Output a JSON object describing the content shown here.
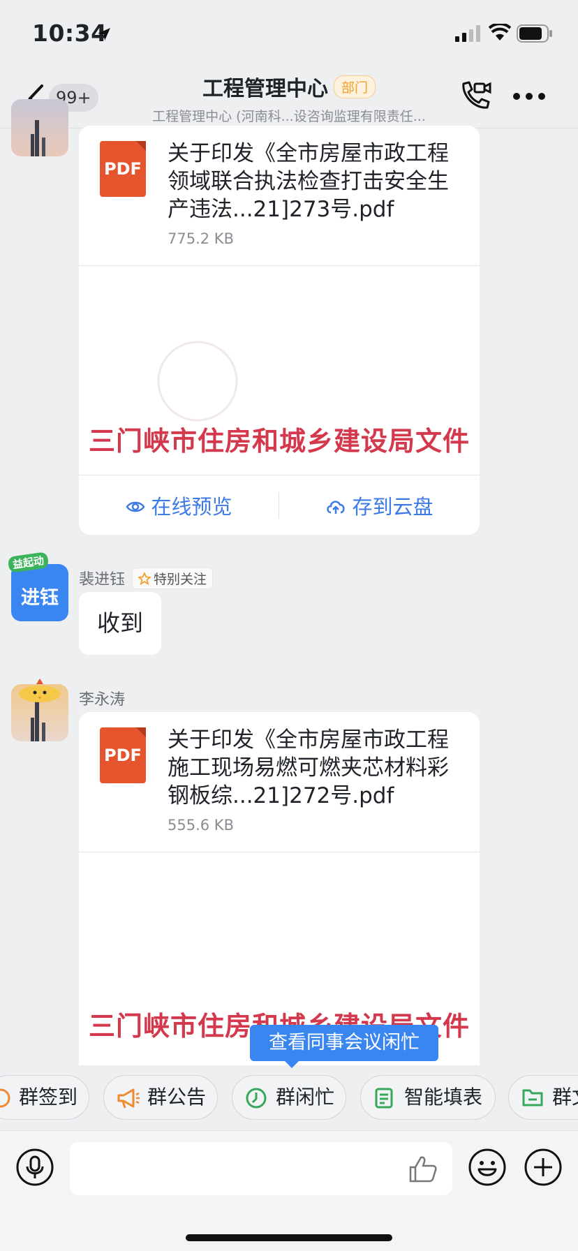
{
  "status_bar": {
    "time": "10:34"
  },
  "header": {
    "unread_badge": "99+",
    "title": "工程管理中心",
    "tag": "部门",
    "subtitle": "工程管理中心 (河南科...设咨询监理有限责任..."
  },
  "messages": [
    {
      "type": "file",
      "file_name": "关于印发《全市房屋市政工程领域联合执法检查打击安全生产违法...21]273号.pdf",
      "file_size": "775.2 KB",
      "preview_heading": "三门峡市住房和城乡建设局文件",
      "actions": {
        "preview": "在线预览",
        "save": "存到云盘"
      }
    },
    {
      "type": "text",
      "sender": "裴进钰",
      "avatar_text": "进钰",
      "avatar_badge": "益起动",
      "sender_tag": "特别关注",
      "text": "收到"
    },
    {
      "type": "file",
      "sender": "李永涛",
      "file_name": "关于印发《全市房屋市政工程施工现场易燃可燃夹芯材料彩钢板综...21]272号.pdf",
      "file_size": "555.6 KB",
      "preview_heading": "三门峡市住房和城乡建设局文件"
    }
  ],
  "tooltip": "查看同事会议闲忙",
  "quick_bar": [
    "群签到",
    "群公告",
    "群闲忙",
    "智能填表",
    "群文"
  ],
  "colors": {
    "accent": "#3a86f0",
    "pdf": "#e6542e",
    "heading_red": "#d4384d",
    "tag_orange": "#f1a02a"
  }
}
